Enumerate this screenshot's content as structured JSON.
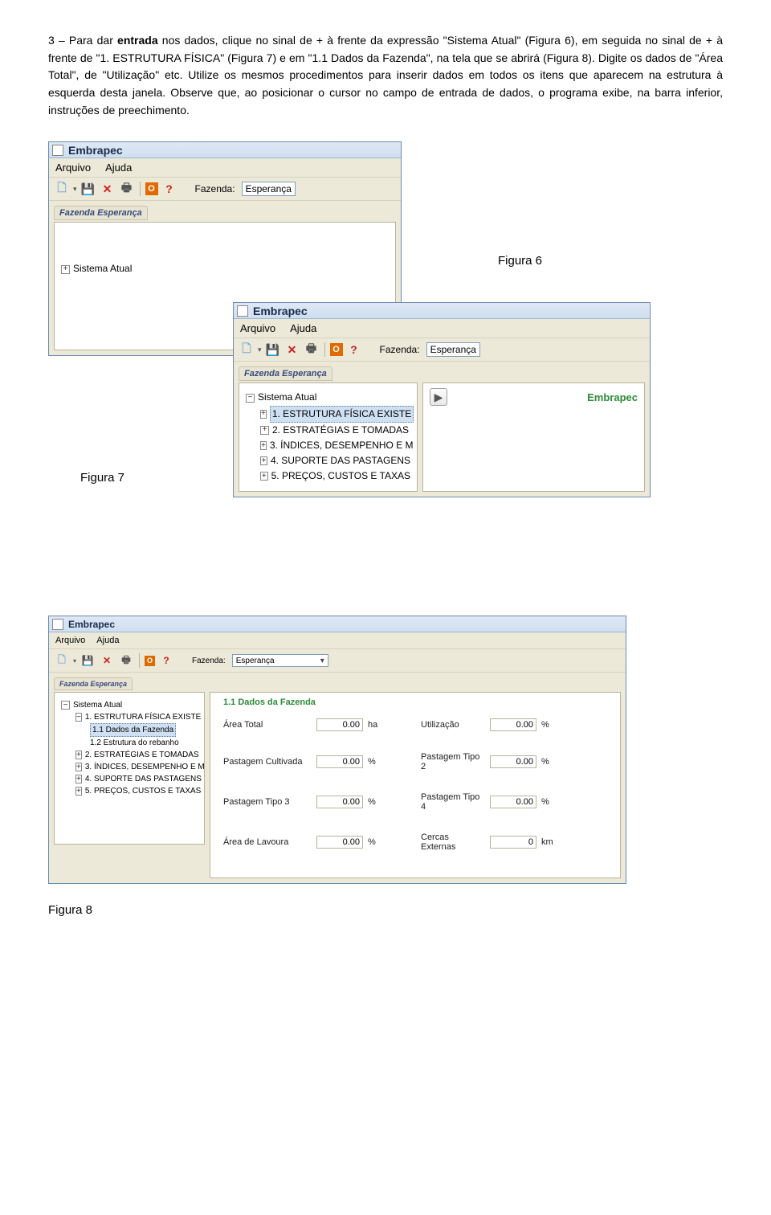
{
  "paragraph": {
    "lead": "3 – Para dar ",
    "bold1": "entrada",
    "rest": " nos dados, clique no sinal de + à frente da expressão \"Sistema Atual\" (Figura 6), em seguida no sinal de + à frente de \"1. ESTRUTURA FÍSICA\" (Figura 7) e em \"1.1 Dados da Fazenda\", na tela que se abrirá (Figura 8). Digite os dados de \"Área Total\", de \"Utilização\" etc. Utilize os mesmos procedimentos para inserir dados em todos os itens que aparecem na estrutura à esquerda desta janela. Observe que, ao posicionar o cursor no campo de entrada de dados, o programa exibe, na barra inferior, instruções de preechimento."
  },
  "captions": {
    "fig6": "Figura 6",
    "fig7": "Figura 7",
    "fig8": "Figura 8"
  },
  "app": {
    "title": "Embrapec",
    "menu_arquivo": "Arquivo",
    "menu_ajuda": "Ajuda",
    "fazenda_label": "Fazenda:",
    "fazenda_value": "Esperança",
    "group_header": "Fazenda Esperança",
    "brand_green": "Embrapec"
  },
  "tree": {
    "root": "Sistema Atual",
    "n1": "1. ESTRUTURA FÍSICA EXISTE",
    "n1_1": "1.1 Dados da Fazenda",
    "n1_2": "1.2 Estrutura do rebanho",
    "n2": "2. ESTRATÉGIAS E TOMADAS",
    "n3": "3. ÍNDICES, DESEMPENHO E M",
    "n4": "4. SUPORTE DAS PASTAGENS",
    "n5": "5. PREÇOS, CUSTOS E TAXAS"
  },
  "form8": {
    "title": "1.1 Dados da Fazenda",
    "row1a_label": "Área Total",
    "row1a_val": "0.00",
    "row1a_unit": "ha",
    "row1b_label": "Utilização",
    "row1b_val": "0.00",
    "row1b_unit": "%",
    "row2a_label": "Pastagem Cultivada",
    "row2a_val": "0.00",
    "row2a_unit": "%",
    "row2b_label": "Pastagem Tipo 2",
    "row2b_val": "0.00",
    "row2b_unit": "%",
    "row3a_label": "Pastagem Tipo 3",
    "row3a_val": "0.00",
    "row3a_unit": "%",
    "row3b_label": "Pastagem Tipo 4",
    "row3b_val": "0.00",
    "row3b_unit": "%",
    "row4a_label": "Área de Lavoura",
    "row4a_val": "0.00",
    "row4a_unit": "%",
    "row4b_label": "Cercas Externas",
    "row4b_val": "0",
    "row4b_unit": "km"
  }
}
